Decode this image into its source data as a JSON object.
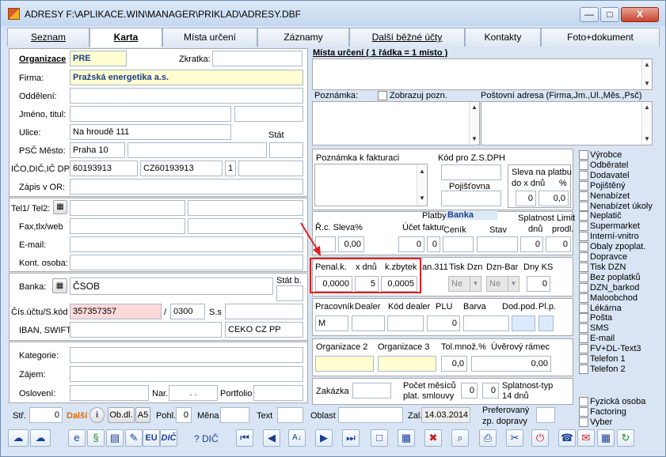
{
  "window": {
    "title": "ADRESY F:\\APLIKACE.WIN\\MANAGER\\PRIKLAD\\ADRESY.DBF",
    "btn_min": "—",
    "btn_max": "□",
    "btn_close": "X"
  },
  "tabs": [
    "Seznam",
    "Karta",
    "Místa určení",
    "Záznamy",
    "Další běžné účty",
    "Kontakty",
    "Foto+dokument"
  ],
  "left": {
    "organizace_label": "Organizace",
    "organizace_value": "PRE",
    "zkratka_label": "Zkratka:",
    "zkratka_value": "",
    "firma_label": "Firma:",
    "firma_value": "Pražská energetika a.s.",
    "oddeleni_label": "Oddělení:",
    "jmeno_label": "Jméno, titul:",
    "ulice_label": "Ulice:",
    "ulice_value": "Na hroudě 111",
    "stat_label": "Stát",
    "psc_label": "PSČ  Město:",
    "psc_value": "Praha 10",
    "ico_label": "IČO,DIČ,IČ DPH",
    "ico_value": "60193913",
    "dic_value": "CZ60193913",
    "dic_extra": "1",
    "zapis_label": "Zápis v OR:",
    "tel_label": "Tel1/ Tel2:",
    "fax_label": "Fax,tlx/web",
    "email_label": "E-mail:",
    "kont_label": "Kont. osoba:",
    "banka_label": "Banka:",
    "banka_value": "ČSOB",
    "statb_label": "Stát b.",
    "ucet_label": "Čís.účtu/S.kód",
    "ucet_value": "357357357",
    "slash": "/",
    "kod_value": "0300",
    "ss_label": "S.s",
    "iban_label": "IBAN, SWIFT",
    "swift_value": "CEKO CZ PP",
    "kategorie_label": "Kategorie:",
    "zajem_label": "Zájem:",
    "osloveni_label": "Oslovení:",
    "nar_label": "Nar.",
    "nar_value": ". .",
    "portfolio_label": "Portfolio"
  },
  "right": {
    "mista_label": "Místa určení ( 1 řádka = 1 místo )",
    "poznamka_label": "Poznámka:",
    "zobrazuj_label": "Zobrazuj pozn.",
    "postovni_label": "Poštovní adresa (Firma,Jm.,Ul.,Měs.,Psč)",
    "pozn_fakt_label": "Poznámka k fakturaci",
    "kod_zs_label": "Kód pro Z.S.DPH",
    "splatnost_label": "Sleva na platbu",
    "dox_label": "do x dnů",
    "pct_label": "%",
    "pojistovna_label": "Pojišťovna",
    "sleva_dny": "0",
    "sleva_pct": "0,0",
    "platby_label": "Platby",
    "banka_badge": "Banka",
    "splatnost2_label": "Splatnost Limit",
    "rc_label": "Ř.c. Sleva%",
    "ucet_fakt_label": "Účet faktur",
    "cenik_label": "Ceník",
    "stav_label": "Stav",
    "dnu_label": "dnů",
    "prodl_label": "prodl.",
    "sleva_val": "0,00",
    "ucet_val1": "0",
    "ucet_val2": "0",
    "dnu_val": "0",
    "prodl_val": "0",
    "penal_label": "Penal.k.",
    "xdnu_label": "x dnů",
    "kzbytek_label": "k.zbytek",
    "an311_label": "an.311",
    "tiskdzn_label": "Tisk Dzn",
    "dznbar_label": "Dzn-Bar",
    "dnyks_label": "Dny KS",
    "penal_val": "0,0000",
    "xdnu_val": "5",
    "kzbytek_val": "0,0005",
    "ne1": "Ne",
    "ne2": "Ne",
    "dnyks_val": "0",
    "pracovnik_label": "Pracovník",
    "dealer_label": "Dealer",
    "kod_dealer_label": "Kód dealer",
    "plu_label": "PLU",
    "barva_label": "Barva",
    "dodpod_label": "Dod.pod.",
    "plp_label": "Pl.p.",
    "pracovnik_val": "M",
    "plu_val": "0",
    "org2_label": "Organizace 2",
    "org3_label": "Organizace 3",
    "tolmn_label": "Tol.množ.%",
    "uver_label": "Úvěrový rámec",
    "tolmn_val": "0,0",
    "uver_val": "0,00",
    "zakazka_label": "Zakázka",
    "pocet_label": "Počet měsíců",
    "plat_smlouvy_label": "plat. smlouvy",
    "pocet_val": "0",
    "splatnost_typ_label": "Splatnost-typ",
    "dni14_label": "14 dnů",
    "splatnost_typ_val": "0"
  },
  "checks": [
    "Výrobce",
    "Odběratel",
    "Dodavatel",
    "Pojištěný",
    "Nenabízet",
    "Nenabízet úkoly",
    "Neplatič",
    "Supermarket",
    "Interní-vnitro",
    "Obaly zpoplat.",
    "Dopravce",
    "Tisk DZN",
    "Bez poplatků",
    "DZN_barkod",
    "Maloobchod",
    "Lékárna",
    "Pošta",
    "SMS",
    "E-mail",
    "FV+DL-Text3",
    "Telefon 1",
    "Telefon 2"
  ],
  "checks2": [
    "Fyzická osoba",
    "Factoring",
    "Vyber"
  ],
  "bottom": {
    "str_label": "Stř.",
    "str_val": "0",
    "dalsi_label": "Další",
    "obdl_label": "Ob.dl.",
    "a5_label": "A5",
    "pohl_label": "Pohl.",
    "pohl_val": "0",
    "mena_label": "Měna",
    "text_label": "Text",
    "oblast_label": "Oblast",
    "zal_label": "Zal.",
    "zal_val": "14.03.2014",
    "preferovany_label": "Preferovaný",
    "zp_dopravy_label": "zp. dopravy"
  },
  "toolbar": {
    "eu_label": "EU",
    "dic_label": "DIČ",
    "dic2_label": "? DIČ"
  }
}
